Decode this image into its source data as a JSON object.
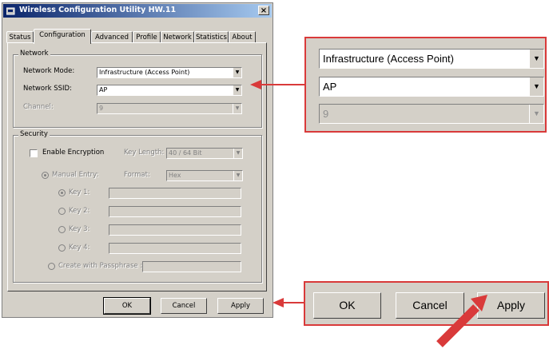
{
  "window": {
    "title": "Wireless Configuration Utility HW.11",
    "close_glyph": "×"
  },
  "tabs": [
    {
      "label": "Status"
    },
    {
      "label": "Configuration",
      "active": true
    },
    {
      "label": "Advanced"
    },
    {
      "label": "Profile"
    },
    {
      "label": "Network"
    },
    {
      "label": "Statistics"
    },
    {
      "label": "About"
    }
  ],
  "network": {
    "legend": "Network",
    "mode_label": "Network Mode:",
    "mode_value": "Infrastructure (Access Point)",
    "ssid_label": "Network SSID:",
    "ssid_value": "AP",
    "channel_label": "Channel:",
    "channel_value": "9"
  },
  "security": {
    "legend": "Security",
    "enable_encryption": "Enable Encryption",
    "key_length_label": "Key Length:",
    "key_length_value": "40 / 64 Bit",
    "manual_entry": "Manual Entry:",
    "format_label": "Format:",
    "format_value": "Hex",
    "keys": [
      "Key 1:",
      "Key 2:",
      "Key 3:",
      "Key 4:"
    ],
    "passphrase": "Create with Passphrase :"
  },
  "buttons": {
    "ok": "OK",
    "cancel": "Cancel",
    "apply": "Apply"
  },
  "zoom": {
    "mode_value": "Infrastructure (Access Point)",
    "ssid_value": "AP",
    "channel_value": "9",
    "ok": "OK",
    "cancel": "Cancel",
    "apply": "Apply"
  },
  "colors": {
    "callout": "#d93a3a",
    "dialog": "#d4d0c8"
  },
  "icons": {
    "dropdown": "▼"
  }
}
